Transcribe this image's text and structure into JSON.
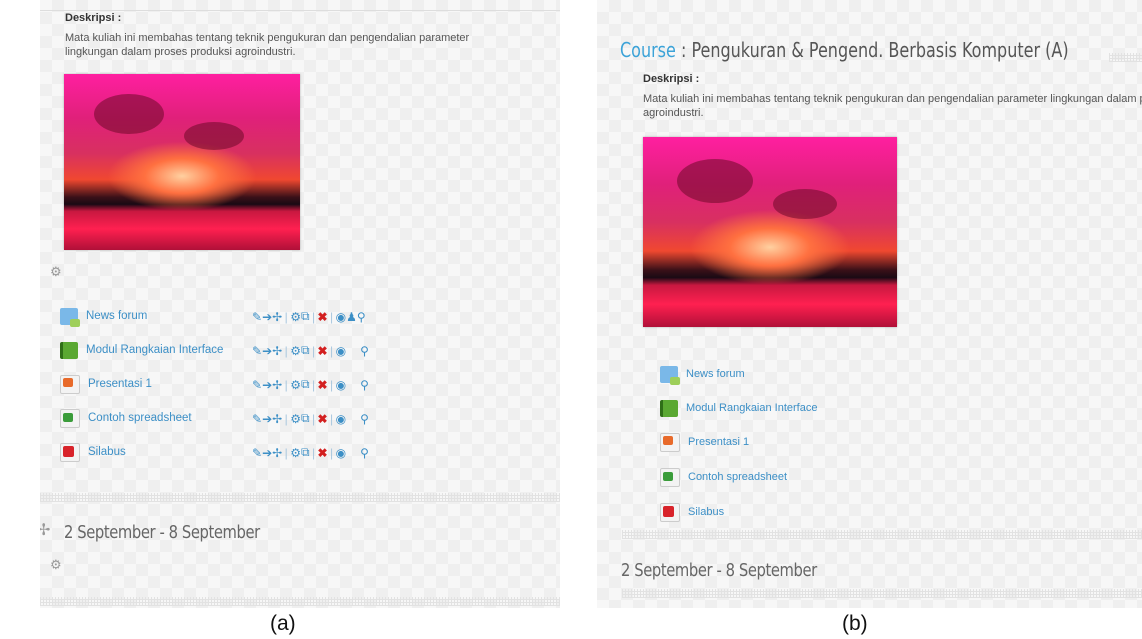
{
  "description_label": "Deskripsi :",
  "description_text": "Mata kuliah ini membahas tentang teknik pengukuran dan pengendalian parameter lingkungan dalam proses produksi agroindustri.",
  "course": {
    "keyword": "Course",
    "separator": ":",
    "name": "Pengukuran & Pengend. Berbasis Komputer (A)"
  },
  "activities": [
    {
      "label": "News forum",
      "icon": "forum-icon"
    },
    {
      "label": "Modul Rangkaian Interface",
      "icon": "book-icon"
    },
    {
      "label": "Presentasi 1",
      "icon": "powerpoint-icon"
    },
    {
      "label": "Contoh spreadsheet",
      "icon": "spreadsheet-icon"
    },
    {
      "label": "Silabus",
      "icon": "pdf-icon"
    }
  ],
  "week_title": "2 September - 8 September",
  "captions": {
    "a": "(a)",
    "b": "(b)"
  },
  "colors": {
    "link": "#3c8fc6",
    "course_keyword": "#3ca3d8",
    "delete": "#d32020"
  }
}
